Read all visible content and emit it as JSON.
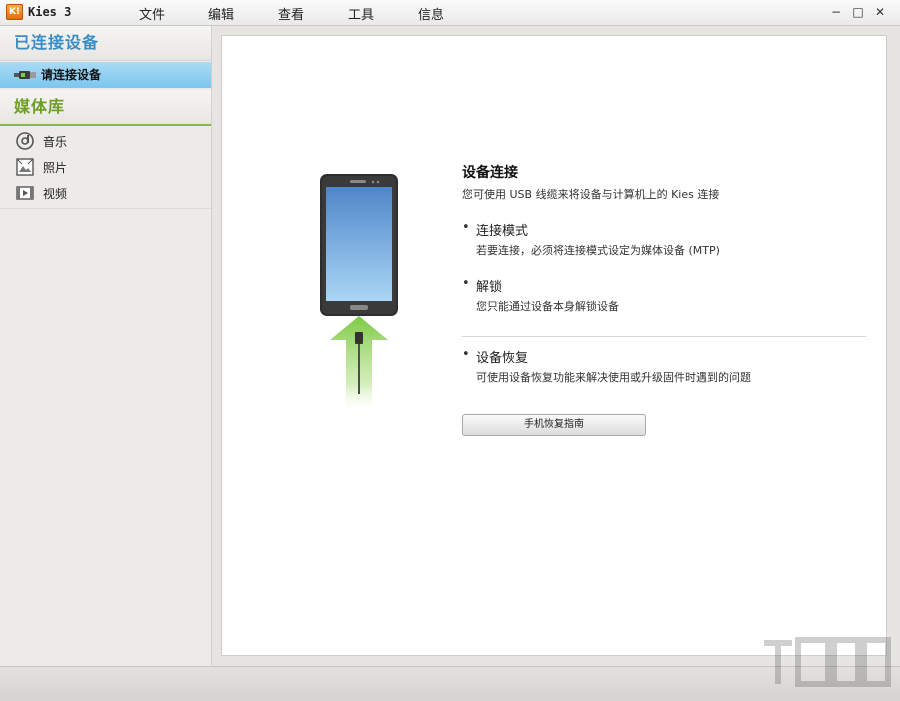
{
  "app": {
    "logo": "K!",
    "title": "Kies 3"
  },
  "menu": [
    {
      "label": "文件"
    },
    {
      "label": "编辑"
    },
    {
      "label": "查看"
    },
    {
      "label": "工具"
    },
    {
      "label": "信息"
    }
  ],
  "window_controls": {
    "minimize": "−",
    "maximize": "□",
    "close": "✕"
  },
  "sidebar": {
    "connected_header": "已连接设备",
    "device_item": {
      "label": "请连接设备",
      "icon": "usb-cable-icon"
    },
    "library_header": "媒体库",
    "library_items": [
      {
        "label": "音乐",
        "icon": "music-icon"
      },
      {
        "label": "照片",
        "icon": "photo-icon"
      },
      {
        "label": "视频",
        "icon": "video-icon"
      }
    ]
  },
  "main": {
    "title": "设备连接",
    "description": "您可使用 USB 线缆来将设备与计算机上的 Kies 连接",
    "bullets": [
      {
        "title": "连接模式",
        "desc": "若要连接，必须将连接模式设定为媒体设备 (MTP)"
      },
      {
        "title": "解锁",
        "desc": "您只能通过设备本身解锁设备"
      }
    ],
    "recovery": {
      "title": "设备恢复",
      "desc": "可使用设备恢复功能来解决使用或升级固件时遇到的问题"
    },
    "guide_button": "手机恢复指南"
  },
  "colors": {
    "connected_header": "#3a8cc4",
    "library_header": "#6d9e26",
    "selected_item": "#7cc6ef",
    "arrow": "#7cc943"
  }
}
